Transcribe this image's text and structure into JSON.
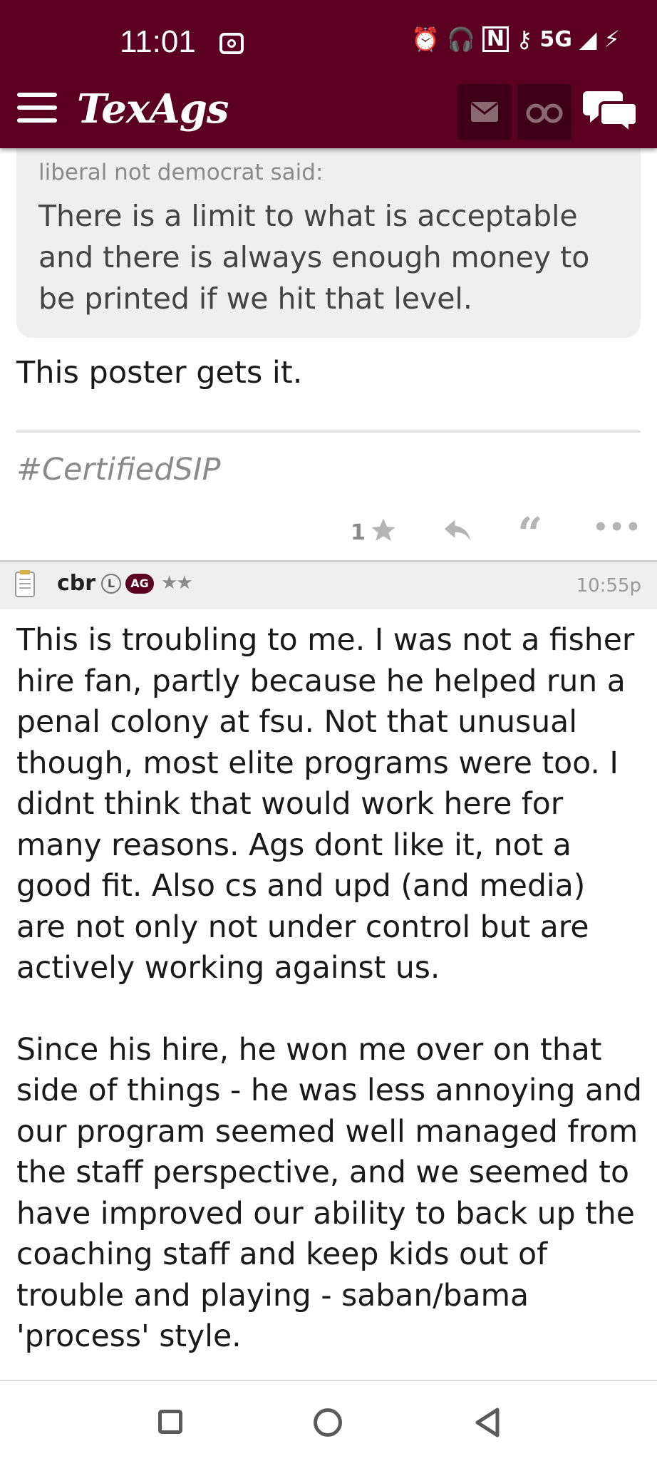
{
  "status_bar": {
    "time": "11:01",
    "network": "5G"
  },
  "header": {
    "logo": "TexAgs"
  },
  "quote": {
    "author": "liberal not democrat said:",
    "text": "There is a limit to what is acceptable and there is always enough money to be printed if we hit that level."
  },
  "previous_post": {
    "reply": "This poster gets it.",
    "signature": "#CertifiedSIP",
    "like_count": "1"
  },
  "post": {
    "username": "cbr",
    "badge_l": "L",
    "badge_ag": "AG",
    "stars": "★★",
    "time": "10:55p",
    "paragraphs": [
      "This is troubling to me. I was not a fisher hire fan, partly because he helped run a penal colony at fsu. Not that unusual though, most elite programs were too. I didnt think that would work here for many reasons. Ags dont like it, not a good fit. Also cs and upd (and media) are not only not under control but are actively working against us.",
      "Since his hire, he won me over on that side of things - he was less annoying and our program seemed well managed from the staff perspective, and we seemed to have improved our ability to back up the coaching staff and keep kids out of trouble and playing - saban/bama 'process' style."
    ]
  },
  "colors": {
    "brand": "#5b0020",
    "brand_dark": "#3e0016"
  },
  "icons": [
    "menu-icon",
    "mail-icon",
    "binoculars-icon",
    "chat-icon",
    "star-icon",
    "reply-icon",
    "quote-icon",
    "more-icon",
    "notepad-icon",
    "recents-icon",
    "home-icon",
    "back-icon"
  ]
}
